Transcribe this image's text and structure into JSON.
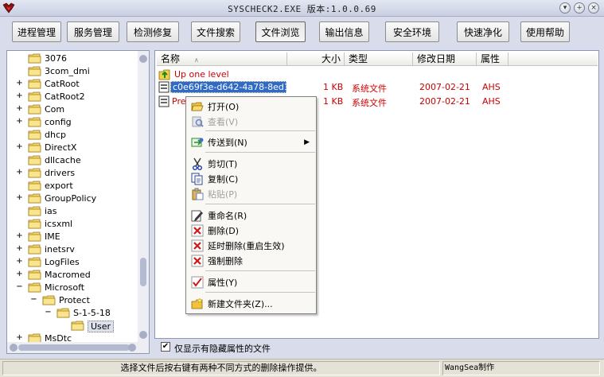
{
  "window": {
    "title": "SYSCHECK2.EXE  版本:1.0.0.69"
  },
  "title_buttons": [
    "▾",
    "+",
    "×"
  ],
  "toolbar": {
    "buttons": [
      {
        "label": "进程管理"
      },
      {
        "label": "服务管理"
      },
      {
        "label": "检测修复"
      },
      {
        "label": "文件搜索"
      },
      {
        "label": "文件浏览"
      },
      {
        "label": "输出信息"
      },
      {
        "label": "安全环境"
      },
      {
        "label": "快速净化"
      },
      {
        "label": "使用帮助"
      }
    ]
  },
  "tree": {
    "items": [
      {
        "label": "3076",
        "expander": ""
      },
      {
        "label": "3com_dmi",
        "expander": ""
      },
      {
        "label": "CatRoot",
        "expander": "+"
      },
      {
        "label": "CatRoot2",
        "expander": "+"
      },
      {
        "label": "Com",
        "expander": "+"
      },
      {
        "label": "config",
        "expander": "+"
      },
      {
        "label": "dhcp",
        "expander": ""
      },
      {
        "label": "DirectX",
        "expander": "+"
      },
      {
        "label": "dllcache",
        "expander": ""
      },
      {
        "label": "drivers",
        "expander": "+"
      },
      {
        "label": "export",
        "expander": ""
      },
      {
        "label": "GroupPolicy",
        "expander": "+"
      },
      {
        "label": "ias",
        "expander": ""
      },
      {
        "label": "icsxml",
        "expander": ""
      },
      {
        "label": "IME",
        "expander": "+"
      },
      {
        "label": "inetsrv",
        "expander": "+"
      },
      {
        "label": "LogFiles",
        "expander": "+"
      },
      {
        "label": "Macromed",
        "expander": "+"
      },
      {
        "label": "Microsoft",
        "expander": "−"
      },
      {
        "label": "Protect",
        "expander": "−"
      },
      {
        "label": "S-1-5-18",
        "expander": "−"
      },
      {
        "label": "User",
        "expander": ""
      },
      {
        "label": "MsDtc",
        "expander": "+"
      }
    ]
  },
  "file_list": {
    "columns": [
      "名称",
      "大小",
      "类型",
      "修改日期",
      "属性"
    ],
    "sort_indicator": "∧",
    "up_label": "Up one level",
    "rows": [
      {
        "name": "c0e69f3e-d642-4a78-8ed1-...",
        "size": "1 KB",
        "type": "系统文件",
        "date": "2007-02-21",
        "attr": "AHS"
      },
      {
        "name": "Pref",
        "size": "1 KB",
        "type": "系统文件",
        "date": "2007-02-21",
        "attr": "AHS"
      }
    ]
  },
  "context_menu": {
    "items": [
      {
        "label": "打开(O)",
        "icon": "open-folder-icon",
        "disabled": false
      },
      {
        "label": "查看(V)",
        "icon": "view-icon",
        "disabled": true
      },
      {
        "label": "传送到(N)",
        "icon": "send-to-icon",
        "disabled": false,
        "submenu": "▶"
      },
      {
        "label": "剪切(T)",
        "icon": "scissors-icon",
        "disabled": false
      },
      {
        "label": "复制(C)",
        "icon": "copy-icon",
        "disabled": false
      },
      {
        "label": "粘贴(P)",
        "icon": "paste-icon",
        "disabled": true
      },
      {
        "label": "重命名(R)",
        "icon": "rename-icon",
        "disabled": false
      },
      {
        "label": "删除(D)",
        "icon": "delete-icon",
        "disabled": false
      },
      {
        "label": "延时删除(重启生效)",
        "icon": "delayed-delete-icon",
        "disabled": false
      },
      {
        "label": "强制删除",
        "icon": "force-delete-icon",
        "disabled": false
      },
      {
        "label": "属性(Y)",
        "icon": "properties-icon",
        "disabled": false
      },
      {
        "label": "新建文件夹(Z)...",
        "icon": "new-folder-icon",
        "disabled": false
      }
    ]
  },
  "options": {
    "show_hidden_only_label": "仅显示有隐藏属性的文件",
    "show_hidden_only_checked": "✔"
  },
  "status": {
    "message": "选择文件后按右键有两种不同方式的删除操作提供。",
    "author": "WangSea制作"
  },
  "colors": {
    "accent_red": "#cc0000",
    "selection": "#316ac5"
  }
}
